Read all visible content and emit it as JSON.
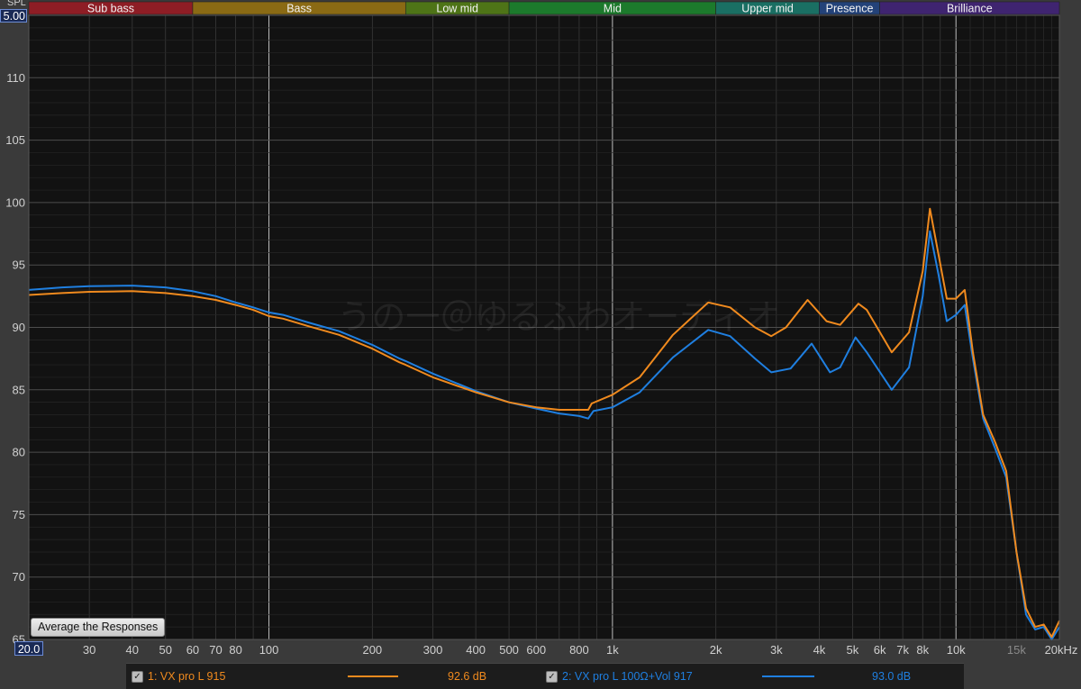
{
  "bands": [
    {
      "label": "Sub bass",
      "from": 20,
      "to": 60,
      "color": "#8e1d25"
    },
    {
      "label": "Bass",
      "from": 60,
      "to": 250,
      "color": "#8a6a14"
    },
    {
      "label": "Low mid",
      "from": 250,
      "to": 500,
      "color": "#4e7417"
    },
    {
      "label": "Mid",
      "from": 500,
      "to": 2000,
      "color": "#1c7a2c"
    },
    {
      "label": "Upper mid",
      "from": 2000,
      "to": 4000,
      "color": "#1a6f63"
    },
    {
      "label": "Presence",
      "from": 4000,
      "to": 6000,
      "color": "#234279"
    },
    {
      "label": "Brilliance",
      "from": 6000,
      "to": 20000,
      "color": "#3f2470"
    }
  ],
  "axis": {
    "ylabel": "SPL",
    "ymax_label": "5.00",
    "xmin_label": "20.0",
    "xunit_label": "20kHz",
    "y_ticks": [
      "110",
      "105",
      "100",
      "95",
      "90",
      "85",
      "80",
      "75",
      "70",
      "65"
    ],
    "x_ticks": [
      {
        "label": "30",
        "value": 30,
        "dim": false
      },
      {
        "label": "40",
        "value": 40,
        "dim": false
      },
      {
        "label": "50",
        "value": 50,
        "dim": false
      },
      {
        "label": "60",
        "value": 60,
        "dim": false
      },
      {
        "label": "70",
        "value": 70,
        "dim": false
      },
      {
        "label": "80",
        "value": 80,
        "dim": false
      },
      {
        "label": "100",
        "value": 100,
        "dim": false
      },
      {
        "label": "200",
        "value": 200,
        "dim": false
      },
      {
        "label": "300",
        "value": 300,
        "dim": false
      },
      {
        "label": "400",
        "value": 400,
        "dim": false
      },
      {
        "label": "500",
        "value": 500,
        "dim": false
      },
      {
        "label": "600",
        "value": 600,
        "dim": false
      },
      {
        "label": "800",
        "value": 800,
        "dim": false
      },
      {
        "label": "1k",
        "value": 1000,
        "dim": false
      },
      {
        "label": "2k",
        "value": 2000,
        "dim": false
      },
      {
        "label": "3k",
        "value": 3000,
        "dim": false
      },
      {
        "label": "4k",
        "value": 4000,
        "dim": false
      },
      {
        "label": "5k",
        "value": 5000,
        "dim": false
      },
      {
        "label": "6k",
        "value": 6000,
        "dim": false
      },
      {
        "label": "7k",
        "value": 7000,
        "dim": false
      },
      {
        "label": "8k",
        "value": 8000,
        "dim": false
      },
      {
        "label": "10k",
        "value": 10000,
        "dim": false
      },
      {
        "label": "15k",
        "value": 15000,
        "dim": true
      }
    ]
  },
  "watermark": "うの一＠ゆるふわオーディオ",
  "average_button_label": "Average the Responses",
  "legend": [
    {
      "check": "✓",
      "label": "1: VX pro L 915",
      "db": "92.6 dB",
      "color": "#f08a1e"
    },
    {
      "check": "✓",
      "label": "2: VX pro L 100Ω+Vol 917",
      "db": "93.0 dB",
      "color": "#1f7fe0"
    }
  ],
  "chart_data": {
    "type": "line",
    "xscale": "log",
    "xlim": [
      20,
      20000
    ],
    "ylim": [
      65,
      115
    ],
    "xlabel": "",
    "ylabel": "SPL",
    "grid": true,
    "legend_position": "bottom",
    "series": [
      {
        "name": "1: VX pro L 915",
        "color": "#f08a1e",
        "points": [
          [
            20,
            92.6
          ],
          [
            25,
            92.75
          ],
          [
            30,
            92.85
          ],
          [
            40,
            92.9
          ],
          [
            50,
            92.75
          ],
          [
            60,
            92.5
          ],
          [
            70,
            92.2
          ],
          [
            80,
            91.8
          ],
          [
            90,
            91.4
          ],
          [
            100,
            90.9
          ],
          [
            110,
            90.7
          ],
          [
            130,
            90.1
          ],
          [
            160,
            89.4
          ],
          [
            200,
            88.3
          ],
          [
            240,
            87.2
          ],
          [
            250,
            87.0
          ],
          [
            300,
            86.0
          ],
          [
            400,
            84.8
          ],
          [
            500,
            84.0
          ],
          [
            600,
            83.6
          ],
          [
            700,
            83.4
          ],
          [
            800,
            83.4
          ],
          [
            850,
            83.4
          ],
          [
            870,
            83.9
          ],
          [
            1000,
            84.6
          ],
          [
            1200,
            86.0
          ],
          [
            1500,
            89.4
          ],
          [
            1900,
            92.0
          ],
          [
            2200,
            91.6
          ],
          [
            2600,
            90.0
          ],
          [
            2900,
            89.3
          ],
          [
            3200,
            90.0
          ],
          [
            3700,
            92.2
          ],
          [
            4200,
            90.5
          ],
          [
            4600,
            90.2
          ],
          [
            5200,
            91.9
          ],
          [
            5500,
            91.4
          ],
          [
            6500,
            88.0
          ],
          [
            7300,
            89.6
          ],
          [
            8000,
            94.5
          ],
          [
            8400,
            99.5
          ],
          [
            8900,
            95.8
          ],
          [
            9400,
            92.3
          ],
          [
            10000,
            92.3
          ],
          [
            10600,
            93.0
          ],
          [
            11200,
            88.0
          ],
          [
            12000,
            83.0
          ],
          [
            13000,
            80.8
          ],
          [
            14000,
            78.5
          ],
          [
            15000,
            72.0
          ],
          [
            16000,
            67.5
          ],
          [
            17000,
            66.0
          ],
          [
            18000,
            66.2
          ],
          [
            19000,
            65.2
          ],
          [
            20000,
            66.5
          ]
        ]
      },
      {
        "name": "2: VX pro L 100Ω+Vol 917",
        "color": "#1f7fe0",
        "points": [
          [
            20,
            93.0
          ],
          [
            25,
            93.2
          ],
          [
            30,
            93.3
          ],
          [
            40,
            93.35
          ],
          [
            50,
            93.2
          ],
          [
            60,
            92.9
          ],
          [
            70,
            92.5
          ],
          [
            80,
            92.0
          ],
          [
            90,
            91.6
          ],
          [
            100,
            91.2
          ],
          [
            110,
            91.0
          ],
          [
            130,
            90.4
          ],
          [
            160,
            89.7
          ],
          [
            200,
            88.6
          ],
          [
            240,
            87.5
          ],
          [
            250,
            87.3
          ],
          [
            300,
            86.3
          ],
          [
            400,
            84.9
          ],
          [
            500,
            84.0
          ],
          [
            600,
            83.5
          ],
          [
            700,
            83.1
          ],
          [
            800,
            82.9
          ],
          [
            850,
            82.7
          ],
          [
            880,
            83.3
          ],
          [
            1000,
            83.6
          ],
          [
            1200,
            84.8
          ],
          [
            1500,
            87.6
          ],
          [
            1900,
            89.8
          ],
          [
            2200,
            89.3
          ],
          [
            2600,
            87.5
          ],
          [
            2900,
            86.4
          ],
          [
            3300,
            86.7
          ],
          [
            3800,
            88.7
          ],
          [
            4300,
            86.4
          ],
          [
            4600,
            86.8
          ],
          [
            5100,
            89.2
          ],
          [
            5500,
            88.0
          ],
          [
            6500,
            85.0
          ],
          [
            7300,
            86.8
          ],
          [
            8000,
            92.5
          ],
          [
            8400,
            97.7
          ],
          [
            8900,
            94.2
          ],
          [
            9400,
            90.5
          ],
          [
            10000,
            91.0
          ],
          [
            10600,
            91.8
          ],
          [
            11200,
            87.5
          ],
          [
            12000,
            82.7
          ],
          [
            13000,
            80.3
          ],
          [
            14000,
            78.0
          ],
          [
            15000,
            72.0
          ],
          [
            16000,
            67.0
          ],
          [
            17000,
            65.8
          ],
          [
            18000,
            66.0
          ],
          [
            19000,
            65.0
          ],
          [
            20000,
            66.0
          ]
        ]
      }
    ]
  }
}
